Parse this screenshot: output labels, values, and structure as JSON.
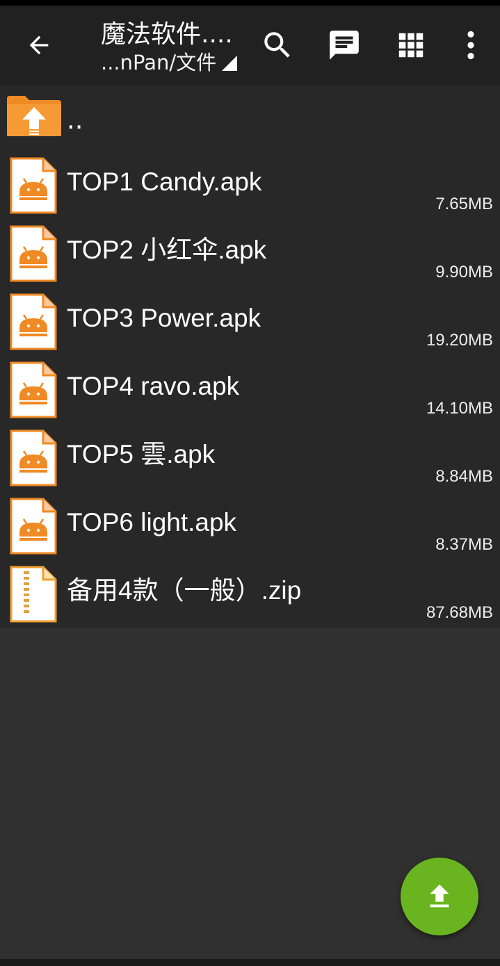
{
  "toolbar": {
    "title": "魔法软件....",
    "subtitle": "...nPan/文件",
    "icons": [
      "back-arrow-icon",
      "search-icon",
      "message-icon",
      "grid-view-icon",
      "more-vert-icon"
    ]
  },
  "parent_label": "..",
  "files": [
    {
      "name": "TOP1  Candy.apk",
      "size": "7.65MB",
      "type": "apk"
    },
    {
      "name": "TOP2  小红伞.apk",
      "size": "9.90MB",
      "type": "apk"
    },
    {
      "name": "TOP3  Power.apk",
      "size": "19.20MB",
      "type": "apk"
    },
    {
      "name": "TOP4  ravo.apk",
      "size": "14.10MB",
      "type": "apk"
    },
    {
      "name": "TOP5  雲.apk",
      "size": "8.84MB",
      "type": "apk"
    },
    {
      "name": "TOP6  light.apk",
      "size": "8.37MB",
      "type": "apk"
    },
    {
      "name": "备用4款（一般）.zip",
      "size": "87.68MB",
      "type": "zip"
    }
  ],
  "colors": {
    "background": "#303030",
    "toolbar": "#212121",
    "list": "#282828",
    "accent_orange": "#f08a24",
    "fab_green": "#6ab41f"
  }
}
